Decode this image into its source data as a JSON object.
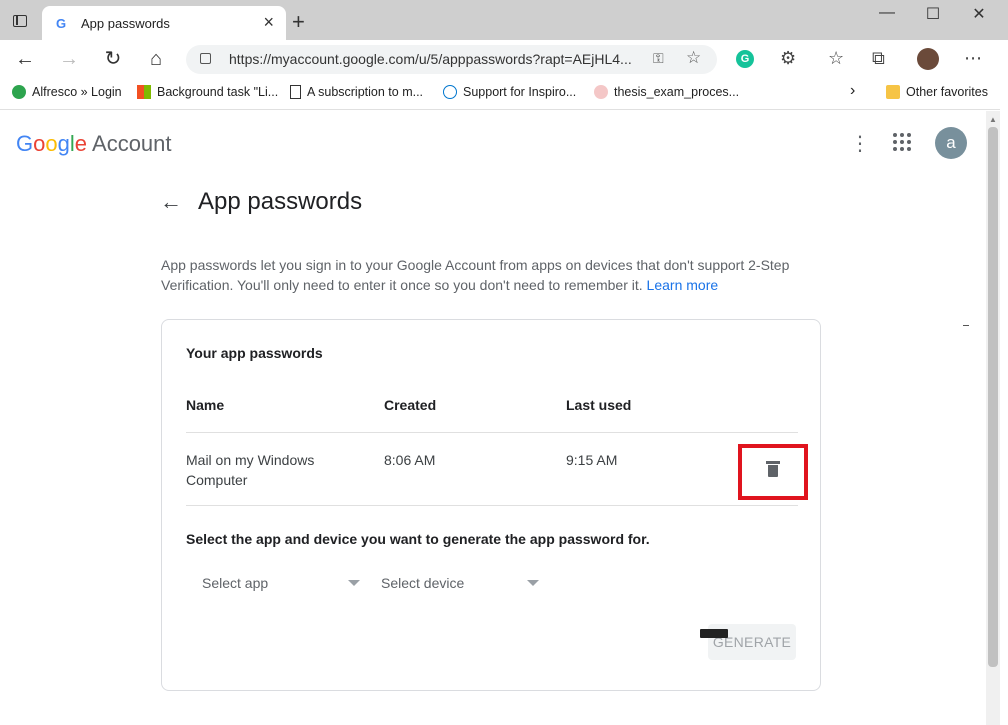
{
  "browser": {
    "tab_title": "App passwords",
    "tab_favicon": "G",
    "url": "https://myaccount.google.com/u/5/apppasswords?rapt=AEjHL4...",
    "bookmarks": [
      {
        "label": "Alfresco » Login",
        "icon": "alfresco-icon"
      },
      {
        "label": "Background task \"Li...",
        "icon": "windows-logo-icon"
      },
      {
        "label": "A subscription to m...",
        "icon": "document-icon"
      },
      {
        "label": "Support for Inspiro...",
        "icon": "dell-icon"
      },
      {
        "label": "thesis_exam_proces...",
        "icon": "bookmark-icon"
      }
    ],
    "other_favorites": "Other favorites",
    "grammarly": "G"
  },
  "header": {
    "logo_google": "Google",
    "logo_account": "Account",
    "avatar_letter": "a"
  },
  "main": {
    "title": "App passwords",
    "description": "App passwords let you sign in to your Google Account from apps on devices that don't support 2-Step Verification. You'll only need to enter it once so you don't need to remember it.",
    "learn_more": "Learn more",
    "card": {
      "title": "Your app passwords",
      "columns": [
        "Name",
        "Created",
        "Last used"
      ],
      "rows": [
        {
          "name": "Mail on my Windows Computer",
          "created": "8:06 AM",
          "last_used": "9:15 AM"
        }
      ],
      "select_heading": "Select the app and device you want to generate the app password for.",
      "select_app": "Select app",
      "select_device": "Select device",
      "generate": "GENERATE"
    }
  },
  "colors": {
    "highlight": "#e0141e",
    "link": "#1a73e8"
  }
}
